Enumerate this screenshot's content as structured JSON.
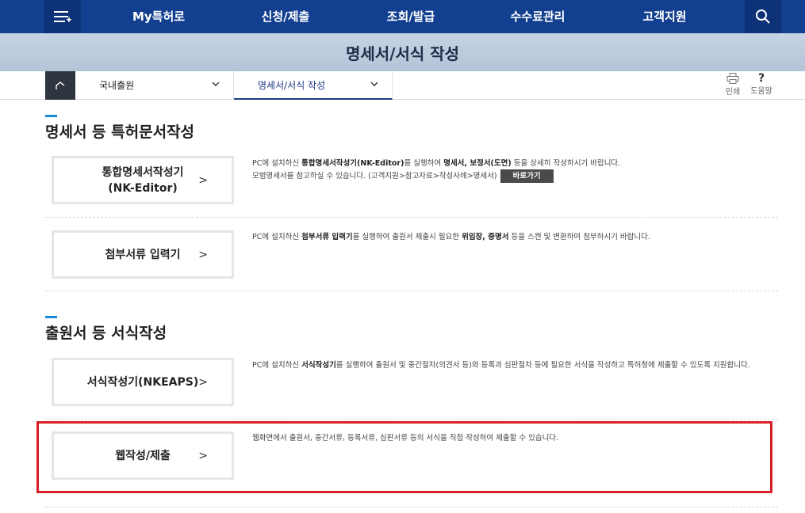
{
  "nav": {
    "items": [
      "My특허로",
      "신청/제출",
      "조회/발급",
      "수수료관리",
      "고객지원"
    ]
  },
  "page_title": "명세서/서식 작성",
  "location": {
    "crumb1": "국내출원",
    "crumb2": "명세서/서식 작성",
    "print_label": "인쇄",
    "help_label": "도움말"
  },
  "section1": {
    "title": "명세서 등 특허문서작성",
    "items": [
      {
        "button": "통합명세서작성기\n(NK-Editor)",
        "desc_line1_pre": "PC에 설치하신 ",
        "desc_line1_b1": "통합명세서작성기(NK-Editor)",
        "desc_line1_mid": "를 실행하여 ",
        "desc_line1_b2": "명세서, 보정서(도면)",
        "desc_line1_post": " 등을 상세히 작성하시기 바랍니다.",
        "desc_line2": "모범명세서를 참고하실 수 있습니다. (고객지원>참고자료>작성사례>명세서)",
        "goto": "바로가기"
      },
      {
        "button": "첨부서류 입력기",
        "desc_pre": "PC에 설치하신 ",
        "desc_b1": "첨부서류 입력기",
        "desc_mid": "를 실행하여 출원서 제출시 필요한 ",
        "desc_b2": "위임장, 증명서",
        "desc_post": " 등을 스캔 및 변환하여 첨부하시기 바랍니다."
      }
    ]
  },
  "section2": {
    "title": "출원서 등 서식작성",
    "items": [
      {
        "button": "서식작성기(NKEAPS)",
        "desc_pre": "PC에 설치하신 ",
        "desc_b1": "서식작성기",
        "desc_post": "를 실행하여 출원서 및 중간절차(의견서 등)와 등록과 심판절차 등에 필요한 서식을 작성하고 특허청에 제출할 수 있도록 지원합니다."
      },
      {
        "button": "웹작성/제출",
        "desc": "웹화면에서 출원서, 중간서류, 등록서류, 심판서류 등의 서식을 직접 작성하여 제출할 수 있습니다."
      }
    ]
  },
  "colors": {
    "nav_bg": "#123f8f",
    "highlight": "#d8202a",
    "accent": "#1d8ad8"
  }
}
